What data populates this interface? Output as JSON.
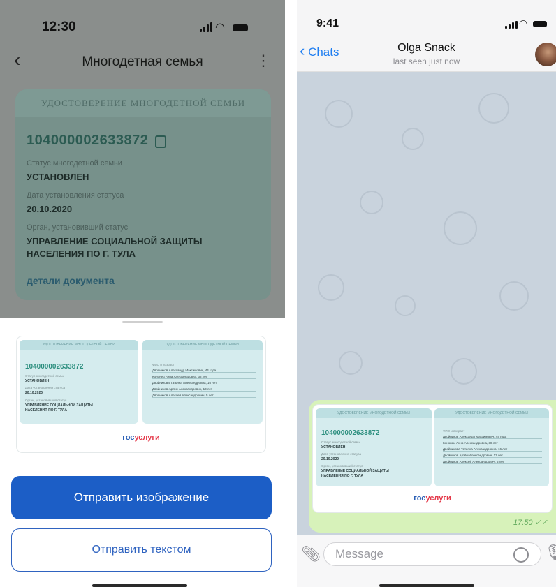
{
  "left": {
    "status": {
      "time": "12:30"
    },
    "nav": {
      "title": "Многодетная семья",
      "back_icon": "chevron-left-icon",
      "menu_icon": "kebab-icon"
    },
    "certificate": {
      "header": "УДОСТОВЕРЕНИЕ МНОГОДЕТНОЙ СЕМЬИ",
      "number": "104000002633872",
      "status_label": "Статус многодетной семьи",
      "status_value": "УСТАНОВЛЕН",
      "date_label": "Дата установления статуса",
      "date_value": "20.10.2020",
      "org_label": "Орган, установивший статус",
      "org_value_line1": "УПРАВЛЕНИЕ СОЦИАЛЬНОЙ ЗАЩИТЫ",
      "org_value_line2": "НАСЕЛЕНИЯ ПО Г. ТУЛА",
      "details_link": "детали документа"
    },
    "preview": {
      "panel_header": "УДОСТОВЕРЕНИЕ МНОГОДЕТНОЙ СЕМЬИ",
      "number": "104000002633872",
      "status_label": "Статус многодетной семьи",
      "status_value": "УСТАНОВЛЕН",
      "date_label": "Дата установления статуса",
      "date_value": "20.10.2020",
      "org_label": "Орган, установивший статус",
      "org_line1": "УПРАВЛЕНИЕ СОЦИАЛЬНОЙ ЗАЩИТЫ",
      "org_line2": "НАСЕЛЕНИЯ ПО Г. ТУЛА",
      "members_label": "ФИО и возраст",
      "members": [
        "Двойников Александр Максимович, 44 года",
        "Кононец Анна Александровна, 38 лет",
        "Двойникова Татьяна Александровна, 16 лет",
        "Двойников Артём Александрович, 13 лет",
        "Двойников Алексей Александрович, 5 лет"
      ],
      "logo_part1": "гос",
      "logo_part2": "услуги"
    },
    "buttons": {
      "send_image": "Отправить изображение",
      "send_text": "Отправить текстом"
    }
  },
  "right": {
    "status": {
      "time": "9:41"
    },
    "header": {
      "back_label": "Chats",
      "contact_name": "Olga Snack",
      "last_seen": "last seen just now",
      "back_icon": "chevron-left-icon"
    },
    "message": {
      "time": "17:50"
    },
    "input": {
      "placeholder": "Message",
      "attach_icon": "paperclip-icon",
      "sticker_icon": "sticker-icon",
      "mic_icon": "microphone-icon"
    }
  },
  "colors": {
    "primary_blue": "#1c5ec6",
    "telegram_blue": "#1f7ef1",
    "bubble_green": "#d7f2ba",
    "certificate_accent": "#2c5b52"
  }
}
